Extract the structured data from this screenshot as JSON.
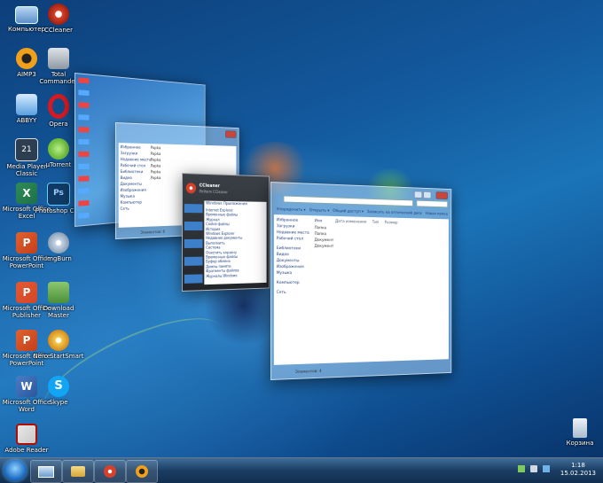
{
  "desktop_icons": [
    {
      "label": "Компьютер",
      "icon": "computer-icon",
      "color": "#7fa9d9"
    },
    {
      "label": "CCleaner",
      "icon": "ccleaner-icon",
      "color": "#d7412b"
    },
    {
      "label": "AIMP3",
      "icon": "aimp-icon",
      "color": "#f0a01a"
    },
    {
      "label": "Total Commander",
      "icon": "total-commander-icon",
      "color": "#9aa3ab"
    },
    {
      "label": "ABBYY",
      "icon": "abbyy-icon",
      "color": "#5aa0e0"
    },
    {
      "label": "Opera",
      "icon": "opera-icon",
      "color": "#d8181f"
    },
    {
      "label": "Media Player Classic",
      "icon": "media-player-icon",
      "color": "#2c3e50"
    },
    {
      "label": "µTorrent",
      "icon": "utorrent-icon",
      "color": "#6fbf3d"
    },
    {
      "label": "Microsoft Office Excel",
      "icon": "excel-icon",
      "color": "#1e7145"
    },
    {
      "label": "Photoshop CS5",
      "icon": "photoshop-icon",
      "color": "#0f3a66"
    },
    {
      "label": "Microsoft Office PowerPoint",
      "icon": "powerpoint-icon",
      "color": "#c43e1c"
    },
    {
      "label": "ImgBurn",
      "icon": "imgburn-icon",
      "color": "#e8eef5"
    },
    {
      "label": "Microsoft Office Publisher",
      "icon": "publisher-icon",
      "color": "#d24726"
    },
    {
      "label": "Download Master",
      "icon": "download-master-icon",
      "color": "#4b8f3a"
    },
    {
      "label": "Microsoft Office Word",
      "icon": "word-icon",
      "color": "#2b579a"
    },
    {
      "label": "Skype",
      "icon": "skype-icon",
      "color": "#12a5f4"
    },
    {
      "label": "Adobe Reader",
      "icon": "adobe-reader-icon",
      "color": "#b30b00"
    },
    {
      "label": "Корзина",
      "icon": "recycle-bin-icon",
      "color": "#c8d6e5"
    }
  ],
  "windows": [
    {
      "id": "desktop-preview",
      "title": ""
    },
    {
      "id": "explorer-back",
      "title": "",
      "status": "Элементов: 6",
      "tree": [
        "Избранное",
        "Загрузки",
        "Недавние места",
        "Рабочий стол",
        "Библиотеки",
        "Видео",
        "Документы",
        "Изображения",
        "Музыка",
        "Компьютер",
        "Сеть"
      ],
      "files": [
        "Papka",
        "Papka",
        "Papka",
        "Papka",
        "Papka",
        "Papka"
      ]
    },
    {
      "id": "ccleaner",
      "title": "CCleaner",
      "subtitle": "Piriform CCleaner",
      "tabs": [
        "Windows",
        "Приложения"
      ],
      "items": [
        "Internet Explorer",
        "Временные файлы",
        "Журнал",
        "Cookie-файлы",
        "История",
        "Windows Explorer",
        "Недавние документы",
        "Выполнить",
        "Система",
        "Очистить корзину",
        "Временные файлы",
        "Буфер обмена",
        "Дампы памяти",
        "Фрагменты файлов",
        "Журналы Windows"
      ]
    },
    {
      "id": "explorer-front",
      "title": "",
      "status": "Элементов: 4",
      "toolbar": [
        "Упорядочить ▾",
        "Открыть ▾",
        "Общий доступ ▾",
        "Записать на оптический диск",
        "Новая папка"
      ],
      "columns": [
        "Имя",
        "Дата изменения",
        "Тип",
        "Размер"
      ],
      "tree": [
        "Избранное",
        "Загрузки",
        "Недавние места",
        "Рабочий стол",
        "Библиотеки",
        "Видео",
        "Документы",
        "Изображения",
        "Музыка",
        "Компьютер",
        "Сеть"
      ],
      "files": [
        "Папка",
        "Папка",
        "Документ",
        "Документ"
      ]
    }
  ],
  "taskbar": {
    "buttons": [
      "windows-explorer",
      "folder",
      "ccleaner",
      "aimp"
    ],
    "clock_time": "1:18",
    "clock_date": "15.02.2013"
  }
}
